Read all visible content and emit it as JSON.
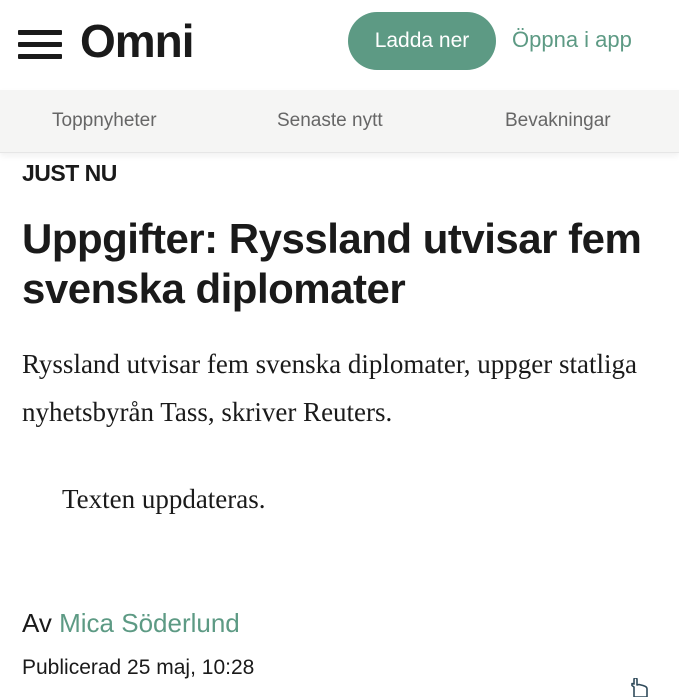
{
  "header": {
    "logo": "Omni",
    "download_label": "Ladda ner",
    "open_app_label": "Öppna i app",
    "accent_color": "#5d9a84"
  },
  "nav": {
    "items": [
      "Toppnyheter",
      "Senaste nytt",
      "Bevakningar"
    ]
  },
  "article": {
    "kicker": "JUST NU",
    "headline": "Uppgifter: Ryssland utvisar fem svenska diplomater",
    "body": "Ryssland utvisar fem svenska diplomater, uppger statliga nyhetsbyrån Tass, skriver Reuters.",
    "update_note": "Texten uppdateras.",
    "byline_prefix": "Av",
    "author": "Mica Söderlund",
    "published": "Publicerad 25 maj, 10:28"
  },
  "icons": {
    "menu": "hamburger-menu-icon",
    "cursor": "hand-pointer-icon"
  }
}
